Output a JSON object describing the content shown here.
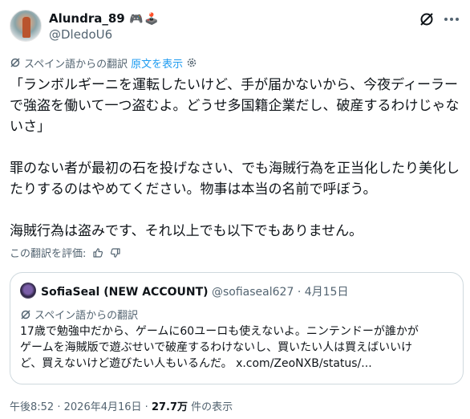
{
  "author": {
    "display_name": "Alundra_89",
    "name_emoji": "🎮🕹️",
    "handle": "@DledoU6"
  },
  "icons": {
    "grok": "grok-icon",
    "more": "more-icon",
    "translate": "translate-icon",
    "settings": "gear-icon",
    "thumbs_up": "thumbs-up-icon",
    "thumbs_down": "thumbs-down-icon"
  },
  "translation": {
    "label": "スペイン語からの翻訳",
    "show_original": "原文を表示"
  },
  "tweet_lines": [
    "「ランボルギーニを運転したいけど、手が届かないから、今夜ディーラー",
    "で強盗を働いて一つ盗むよ。どうせ多国籍企業だし、破産するわけじゃな",
    "いさ」",
    "",
    "罪のない者が最初の石を投げなさい、でも海賊行為を正当化したり美化し",
    "たりするのはやめてください。物事は本当の名前で呼ぼう。",
    "",
    "海賊行為は盗みです、それ以上でも以下でもありません。"
  ],
  "rate": {
    "label": "この翻訳を評価:"
  },
  "quote": {
    "display_name": "SofiaSeal (NEW ACCOUNT)",
    "handle": "@sofiaseal627",
    "separator": "·",
    "date": "4月15日",
    "translation_label": "スペイン語からの翻訳",
    "lines": [
      "17歳で勉強中だから、ゲームに60ユーロも使えないよ。ニンテンドーが誰かが",
      "ゲームを海賊版で遊ぶせいで破産するわけないし、買いたい人は買えばいいけ"
    ],
    "last_line_text": "ど、買えないけど遊びたい人もいるんだ。",
    "link": "x.com/ZeoNXB/status/..."
  },
  "meta": {
    "time": "午後8:52",
    "separator": "·",
    "date": "2026年4月16日",
    "views": "27.7万",
    "views_label": "件の表示"
  },
  "colors": {
    "text": "#0f1419",
    "secondary": "#536471",
    "link": "#1d9bf0",
    "border": "#cfd9de"
  }
}
